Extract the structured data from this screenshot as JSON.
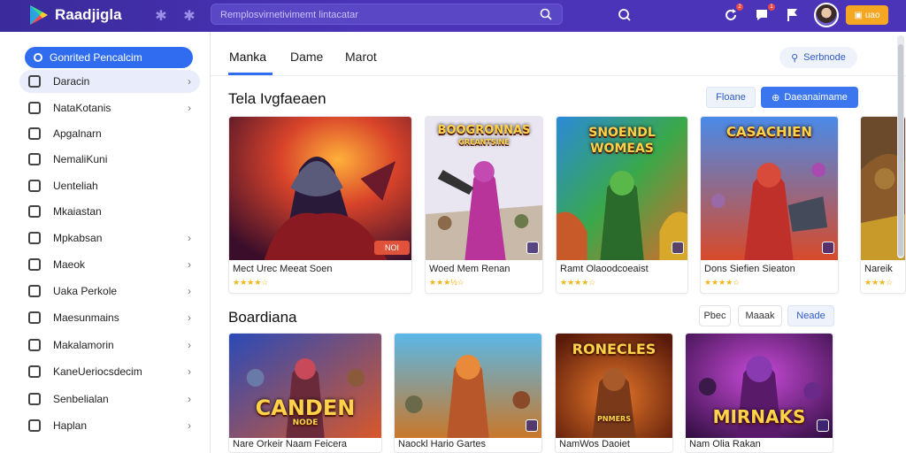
{
  "header": {
    "brand": "Raadjigla",
    "search_placeholder": "Remplosvirnetivimemt lintacatar",
    "cta_label": "uao",
    "notification_counts": [
      "2",
      "1"
    ]
  },
  "sidebar": {
    "category_button": "Gonrited Pencalcim",
    "items": [
      {
        "label": "Daracin",
        "chevron": true,
        "active": true
      },
      {
        "label": "NataKotanis",
        "chevron": true
      },
      {
        "label": "Apgalnarn",
        "chevron": false
      },
      {
        "label": "NemaliKuni",
        "chevron": false
      },
      {
        "label": "Uenteliah",
        "chevron": false
      },
      {
        "label": "Mkaiastan",
        "chevron": false
      },
      {
        "label": "Mpkabsan",
        "chevron": true
      },
      {
        "label": "Maeok",
        "chevron": true
      },
      {
        "label": "Uaka Perkole",
        "chevron": true
      },
      {
        "label": "Maesunmains",
        "chevron": true
      },
      {
        "label": "Makalamorin",
        "chevron": true
      },
      {
        "label": "KaneUeriocsdecim",
        "chevron": true
      },
      {
        "label": "Senbelialan",
        "chevron": true
      },
      {
        "label": "Haplan",
        "chevron": true
      }
    ]
  },
  "main": {
    "tabs": [
      "Manka",
      "Dame",
      "Marot"
    ],
    "active_tab": 0,
    "search_button": "Serbnode",
    "section1": {
      "title": "Tela Ivgfaeaen",
      "buttons": [
        "Floane",
        "Daeanaimame"
      ],
      "cards": [
        {
          "art_title": "",
          "name": "Mect Urec Meeat Soen",
          "rating": 4,
          "price": "NOI"
        },
        {
          "art_title": "BOOGRONNAS",
          "art_subtitle": "GREANTSINE",
          "name": "Woed Mem Renan",
          "rating": 3.5
        },
        {
          "art_title": "SNOENDL",
          "art_subtitle": "WOMEAS",
          "name": "Ramt Olaoodcoeaist",
          "rating": 4
        },
        {
          "art_title": "CASACHIEN",
          "name": "Dons Siefien Sieaton",
          "rating": 4
        },
        {
          "art_title": "",
          "name": "Nareik",
          "rating": 3
        }
      ]
    },
    "section2": {
      "title": "Boardiana",
      "buttons": [
        "Pbec",
        "Maaak",
        "Neade"
      ],
      "cards": [
        {
          "art_title": "CANDEN",
          "art_subtitle": "NODE",
          "name": "Nare Orkeir Naam Feicera"
        },
        {
          "art_title": "",
          "name": "Naockl Hario Gartes"
        },
        {
          "art_title": "RONECLES",
          "art_subtitle": "PNMERS",
          "name": "NamWos Daoiet"
        },
        {
          "art_title": "MIRNAKS",
          "name": "Nam Olia Rakan"
        }
      ]
    }
  },
  "colors": {
    "header_bg": "#4b34b8",
    "accent_blue": "#2f6cf0",
    "cta_orange": "#f5a623",
    "star": "#f3b41b"
  }
}
